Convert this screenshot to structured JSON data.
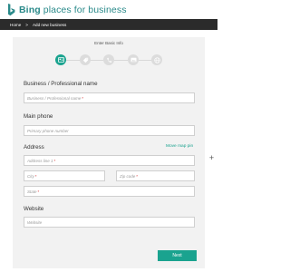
{
  "header": {
    "brand": "Bing",
    "product": "places for business"
  },
  "breadcrumb": {
    "home": "Home",
    "separator": ">",
    "current": "Add new business"
  },
  "stepper": {
    "title": "Enter Basic Info",
    "steps": [
      {
        "icon": "id-card-icon",
        "active": true
      },
      {
        "icon": "tag-icon",
        "active": false
      },
      {
        "icon": "phone-icon",
        "active": false
      },
      {
        "icon": "image-icon",
        "active": false
      },
      {
        "icon": "globe-icon",
        "active": false
      }
    ]
  },
  "form": {
    "business_name": {
      "label": "Business / Professional name",
      "placeholder": "Business / Professional name",
      "required": "*"
    },
    "main_phone": {
      "label": "Main phone",
      "placeholder": "Primary phone number"
    },
    "address": {
      "label": "Address",
      "map_link": "Move map pin",
      "line1_placeholder": "Address line 1",
      "city_placeholder": "City",
      "zip_placeholder": "Zip code",
      "state_placeholder": "State",
      "required": "*",
      "add_label": "+"
    },
    "website": {
      "label": "Website",
      "placeholder": "Website"
    },
    "next_label": "Next"
  },
  "colors": {
    "accent": "#1aa38f",
    "brand": "#2a8a8a",
    "crumb_bg": "#2b2b2b"
  }
}
